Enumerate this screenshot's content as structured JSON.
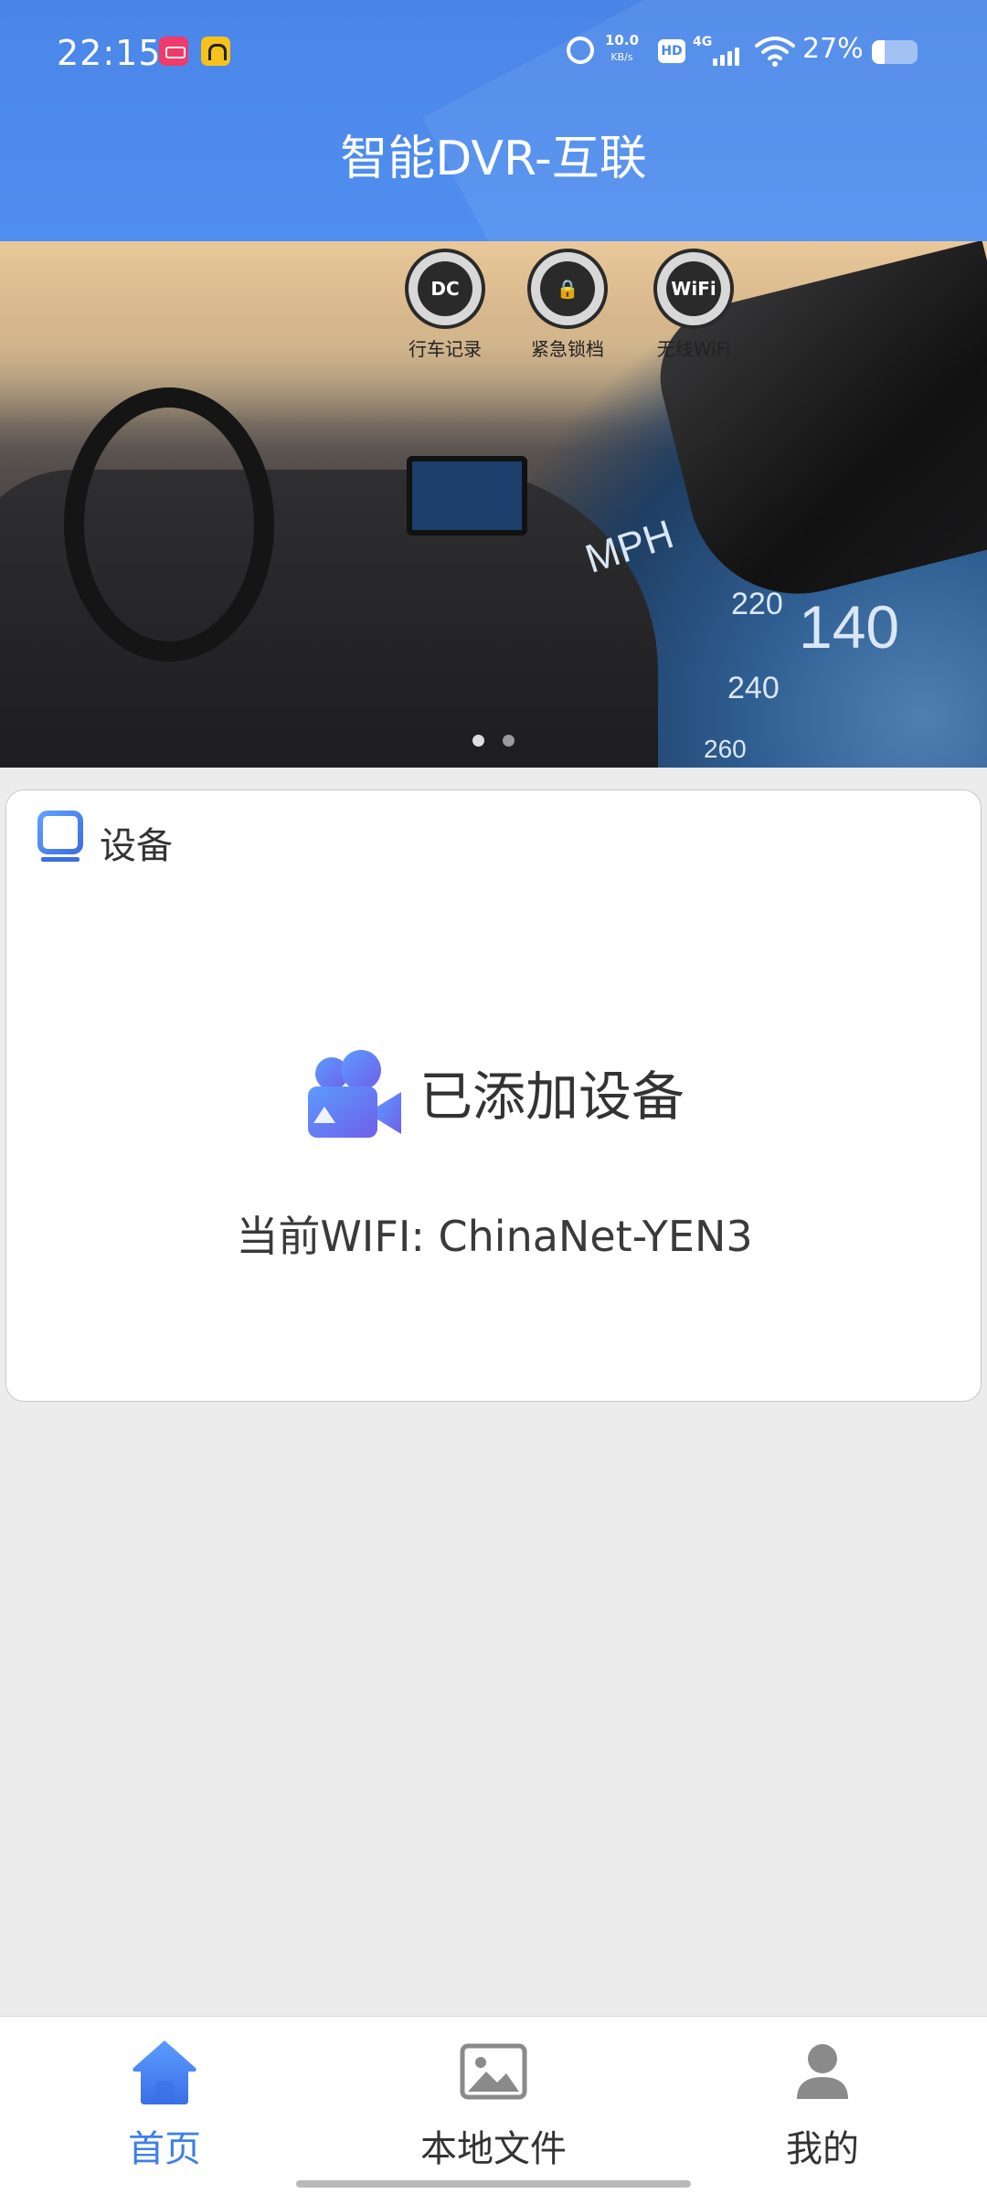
{
  "status_bar": {
    "time": "22:15",
    "net_speed_value": "10.0",
    "net_speed_unit": "KB/s",
    "hd_label": "HD",
    "network_type": "4G",
    "battery_percent": "27%",
    "battery_level": 0.27,
    "icons": [
      "alarm-icon",
      "hd-icon",
      "signal-icon",
      "wifi-icon",
      "battery-icon"
    ]
  },
  "header": {
    "title": "智能DVR-互联"
  },
  "banner": {
    "features": [
      {
        "icon": "dashcam-icon",
        "label": "行车记录",
        "glyph": "DC"
      },
      {
        "icon": "car-lock-icon",
        "label": "紧急锁档",
        "glyph": "🔒"
      },
      {
        "icon": "wifi-badge-icon",
        "label": "无线WiFi",
        "glyph": "WiFi"
      }
    ],
    "speed_labels": [
      "MPH",
      "140",
      "220",
      "240",
      "260"
    ],
    "page_count": 2,
    "active_page": 1
  },
  "device_card": {
    "title": "设备",
    "title_icon": "monitor-icon",
    "status_icon": "camcorder-icon",
    "status_text": "已添加设备",
    "wifi_text": "当前WIFI: ChinaNet-YEN3"
  },
  "bottom_nav": {
    "items": [
      {
        "label": "首页",
        "icon": "home-icon",
        "active": true
      },
      {
        "label": "本地文件",
        "icon": "image-icon",
        "active": false
      },
      {
        "label": "我的",
        "icon": "user-icon",
        "active": false
      }
    ]
  },
  "colors": {
    "primary": "#4a86e8",
    "active_nav": "#3d80e6",
    "background": "#ececec",
    "card": "#ffffff"
  }
}
